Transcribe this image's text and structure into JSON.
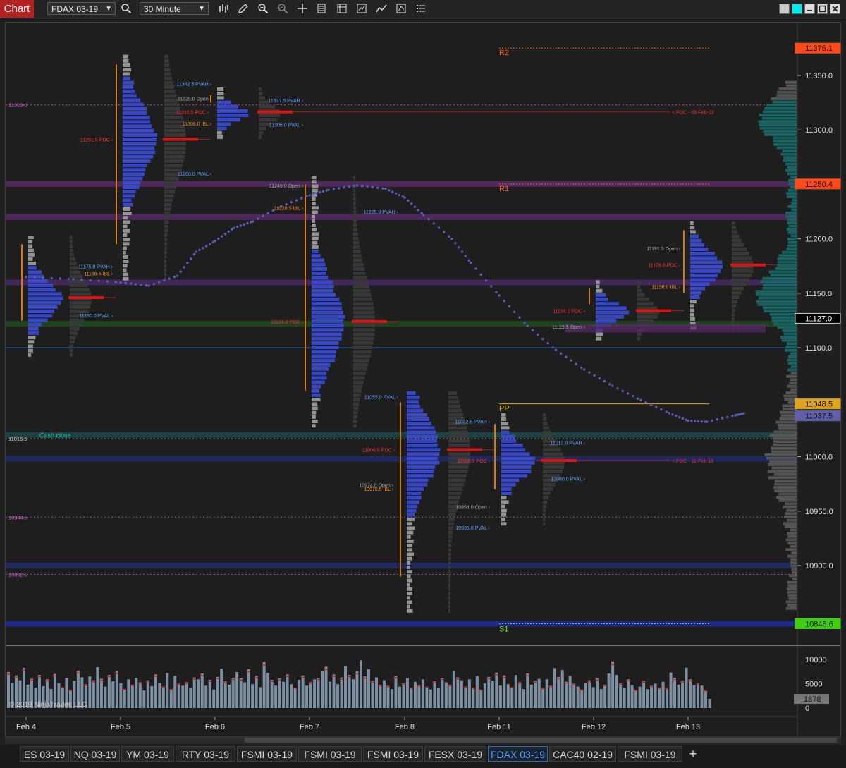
{
  "toolbar": {
    "chart_label": "Chart",
    "instrument": "FDAX 03-19",
    "interval": "30 Minute",
    "tools": [
      "search-icon",
      "bar-type-icon",
      "pencil-icon",
      "zoom-in-icon",
      "zoom-out-icon",
      "crosshair-icon",
      "data-box-icon",
      "properties-icon",
      "strategies-icon",
      "indicators-icon",
      "template-icon",
      "list-icon"
    ]
  },
  "tabs": [
    "ES 03-19",
    "NQ 03-19",
    "YM 03-19",
    "RTY 03-19",
    "FSMI 03-19",
    "FSMI 03-19",
    "FSMI 03-19",
    "FESX 03-19",
    "FDAX 03-19",
    "CAC40 02-19",
    "FSMI 03-19"
  ],
  "active_tab": "FDAX 03-19",
  "copyright": "© 2019 NinjaTrader, LLC",
  "chart_data": {
    "type": "bar",
    "title": "",
    "x_labels": [
      "Feb 4",
      "Feb 5",
      "Feb 6",
      "Feb 7",
      "Feb 8",
      "Feb 11",
      "Feb 12",
      "Feb 13"
    ],
    "price_axis": {
      "ticks": [
        "11350.0",
        "11300.0",
        "11250.0",
        "11200.0",
        "11150.0",
        "11100.0",
        "11050.0",
        "11000.0",
        "10950.0",
        "10900.0"
      ],
      "range": [
        10820,
        11395
      ]
    },
    "price_markers": [
      {
        "value": 11375.1,
        "label": "11375.1",
        "color": "#ff4a1a"
      },
      {
        "value": 11250.4,
        "label": "11250.4",
        "color": "#ff4a1a"
      },
      {
        "value": 11127.0,
        "label": "11127.0",
        "color": "#000000"
      },
      {
        "value": 11048.5,
        "label": "11048.5",
        "color": "#e0a520"
      },
      {
        "value": 11037.5,
        "label": "11037.5",
        "color": "#6060aa"
      },
      {
        "value": 10846.6,
        "label": "10846.6",
        "color": "#40d010"
      }
    ],
    "pivot_labels": [
      {
        "label": "R2",
        "value": 11375.1,
        "color": "#ff5a20"
      },
      {
        "label": "R1",
        "value": 11250.4,
        "color": "#ff5a20"
      },
      {
        "label": "PP",
        "value": 11048.5,
        "color": "#e0b020"
      },
      {
        "label": "S1",
        "value": 10846.6,
        "color": "#70e020"
      }
    ],
    "level_labels": [
      {
        "label": "11323.0",
        "value": 11323.0,
        "color": "#d060d0"
      },
      {
        "label": "11016.5",
        "value": 11016.5,
        "color": "#d0d0d0"
      },
      {
        "label": "10944.5",
        "value": 10944.5,
        "color": "#d060d0"
      },
      {
        "label": "10892.0",
        "value": 10892.0,
        "color": "#d060d0"
      }
    ],
    "profile_annotations": [
      {
        "label": "11342.5 PVAH",
        "value": 11342.5,
        "color": "#5fa0ff"
      },
      {
        "label": "11329.0 Open",
        "value": 11329.0,
        "color": "#aaaaaa"
      },
      {
        "label": "11316.5 POC",
        "value": 11316.5,
        "color": "#ff3030"
      },
      {
        "label": "11306.0 IBL",
        "value": 11306.0,
        "color": "#f09020"
      },
      {
        "label": "11327.5 PVAH",
        "value": 11327.5,
        "color": "#5fa0ff"
      },
      {
        "label": "11305.0 PVAL",
        "value": 11305.0,
        "color": "#5fa0ff"
      },
      {
        "label": "11291.5 POC",
        "value": 11291.5,
        "color": "#ff3030"
      },
      {
        "label": "11260.0 PVAL",
        "value": 11260.0,
        "color": "#5fa0ff"
      },
      {
        "label": "11249.0 Open",
        "value": 11249.0,
        "color": "#aaaaaa"
      },
      {
        "label": "11228.5 IBL",
        "value": 11228.5,
        "color": "#f09020"
      },
      {
        "label": "11225.0 PVAH",
        "value": 11225.0,
        "color": "#5fa0ff"
      },
      {
        "label": "11175.0 PVAH",
        "value": 11175.0,
        "color": "#5fa0ff"
      },
      {
        "label": "11168.5 IBL",
        "value": 11168.5,
        "color": "#f09020"
      },
      {
        "label": "11130.0 PVAL",
        "value": 11130.0,
        "color": "#5fa0ff"
      },
      {
        "label": "11124.0 POC",
        "value": 11124.0,
        "color": "#ff3030"
      },
      {
        "label": "11055.0 PVAL",
        "value": 11055.0,
        "color": "#5fa0ff"
      },
      {
        "label": "11032.5 PVAH",
        "value": 11032.5,
        "color": "#5fa0ff"
      },
      {
        "label": "11013.0 PVAH",
        "value": 11013.0,
        "color": "#5fa0ff"
      },
      {
        "label": "11006.5 POC",
        "value": 11006.5,
        "color": "#ff3030"
      },
      {
        "label": "10996.5 POC",
        "value": 10996.5,
        "color": "#ff3030"
      },
      {
        "label": "10980.0 PVAL",
        "value": 10980.0,
        "color": "#5fa0ff"
      },
      {
        "label": "10974.0 Open",
        "value": 10974.0,
        "color": "#aaaaaa"
      },
      {
        "label": "10970.5 IBL",
        "value": 10970.5,
        "color": "#f09020"
      },
      {
        "label": "10954.0 Open",
        "value": 10954.0,
        "color": "#aaaaaa"
      },
      {
        "label": "10935.0 PVAL",
        "value": 10935.0,
        "color": "#5fa0ff"
      },
      {
        "label": "11191.5 Open",
        "value": 11191.5,
        "color": "#aaaaaa"
      },
      {
        "label": "11176.0 POC",
        "value": 11176.0,
        "color": "#ff3030"
      },
      {
        "label": "11156.0 IBL",
        "value": 11156.0,
        "color": "#f09020"
      },
      {
        "label": "11134.0 POC",
        "value": 11134.0,
        "color": "#ff3030"
      },
      {
        "label": "11119.5 Open",
        "value": 11119.5,
        "color": "#aaaaaa"
      }
    ],
    "naked_poc_labels": [
      {
        "label": "< POC - 06-Feb-19",
        "value": 11316.5
      },
      {
        "label": "< POC - 11-Feb-19",
        "value": 10996.5
      }
    ],
    "edge_labels": [
      {
        "label": "Cash close",
        "value": 11020.0,
        "color": "#30c0b0"
      }
    ],
    "volume": {
      "ticks": [
        "10000",
        "5000",
        "0"
      ],
      "last": "1878",
      "values": [
        7400,
        5200,
        6700,
        5700,
        8300,
        4800,
        6000,
        4200,
        6800,
        4500,
        5900,
        3900,
        7000,
        5100,
        4300,
        6200,
        3700,
        5600,
        7700,
        6300,
        4900,
        6500,
        5700,
        8400,
        6000,
        4400,
        6800,
        5500,
        7600,
        5100,
        3900,
        5900,
        4800,
        6200,
        5300,
        3600,
        5700,
        4500,
        6900,
        5200,
        4400,
        7200,
        3900,
        6600,
        5000,
        4600,
        5300,
        4100,
        6300,
        5900,
        7100,
        4600,
        5800,
        3800,
        6400,
        8100,
        5500,
        4800,
        6200,
        7400,
        6100,
        5300,
        8000,
        4900,
        6600,
        4300,
        9500,
        7200,
        5800,
        4600,
        6100,
        5400,
        6900,
        4900,
        4200,
        5800,
        6700,
        4600,
        5300,
        5900,
        6200,
        7600,
        8500,
        5400,
        6900,
        4900,
        6300,
        8600,
        6800,
        5900,
        7500,
        9800,
        6500,
        8000,
        5600,
        6300,
        4800,
        5700,
        4600,
        3900,
        6600,
        4400,
        5100,
        6100,
        4200,
        5400,
        4700,
        5900,
        4400,
        3800,
        5500,
        4100,
        6200,
        5300,
        4800,
        7600,
        6300,
        5700,
        4400,
        5900,
        4200,
        6600,
        3800,
        5100,
        6400,
        5600,
        7300,
        4600,
        6700,
        4900,
        4300,
        6800,
        5300,
        3900,
        7100,
        4800,
        5600,
        6000,
        4100,
        5900,
        4600,
        8200,
        6400,
        7800,
        5400,
        6600,
        5000,
        4400,
        3800,
        5200,
        5700,
        4300,
        6100,
        3900,
        4800,
        7100,
        9600,
        6800,
        5100,
        4200,
        5900,
        4700,
        3700,
        4400,
        5600,
        3900,
        4600,
        5000,
        4200,
        5400,
        4100,
        7300,
        6200,
        4800,
        5600,
        8300,
        5900,
        4700,
        5200,
        4600,
        3600,
        1878
      ]
    },
    "vwap_dots": [
      [
        0.0,
        11165
      ],
      [
        0.5,
        11163
      ],
      [
        1.0,
        11160
      ],
      [
        1.3,
        11157
      ],
      [
        1.6,
        11166
      ],
      [
        1.8,
        11188
      ],
      [
        2.0,
        11198
      ],
      [
        2.2,
        11210
      ],
      [
        2.4,
        11216
      ],
      [
        2.7,
        11230
      ],
      [
        3.0,
        11240
      ],
      [
        3.2,
        11245
      ],
      [
        3.5,
        11249
      ],
      [
        3.8,
        11246
      ],
      [
        4.0,
        11238
      ],
      [
        4.2,
        11222
      ],
      [
        4.5,
        11200
      ],
      [
        4.7,
        11178
      ],
      [
        5.0,
        11148
      ],
      [
        5.3,
        11120
      ],
      [
        5.6,
        11098
      ],
      [
        5.9,
        11080
      ],
      [
        6.2,
        11065
      ],
      [
        6.5,
        11052
      ],
      [
        6.8,
        11040
      ],
      [
        7.0,
        11033
      ],
      [
        7.2,
        11032
      ],
      [
        7.5,
        11038
      ],
      [
        7.6,
        11040
      ]
    ]
  }
}
